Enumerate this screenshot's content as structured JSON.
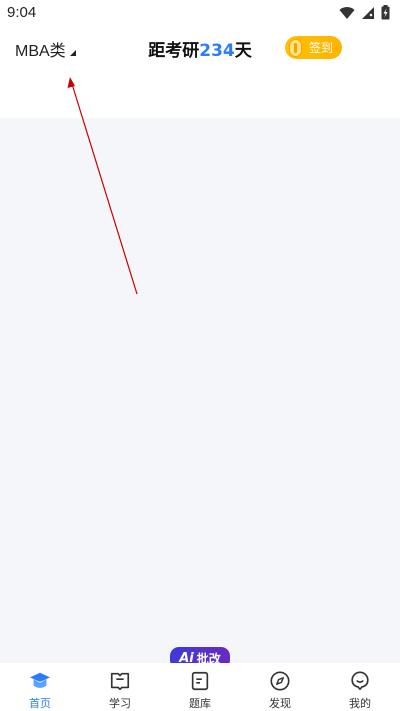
{
  "status": {
    "time": "9:04"
  },
  "header": {
    "category": "MBA类",
    "countdown_prefix": "距考研",
    "countdown_days": "234",
    "countdown_suffix": "天",
    "checkin_label": "签到"
  },
  "tabbar": {
    "ai_badge_ai": "Ai",
    "ai_badge_text": "批改",
    "items": [
      {
        "label": "首页",
        "icon": "graduation-cap-icon"
      },
      {
        "label": "学习",
        "icon": "book-icon"
      },
      {
        "label": "题库",
        "icon": "notepad-icon"
      },
      {
        "label": "发现",
        "icon": "compass-icon"
      },
      {
        "label": "我的",
        "icon": "user-face-icon"
      }
    ]
  },
  "colors": {
    "accent": "#2c7ef8",
    "checkin": "#ffc107",
    "ai_badge": "#4b34cc",
    "annotation": "#cc0000"
  }
}
